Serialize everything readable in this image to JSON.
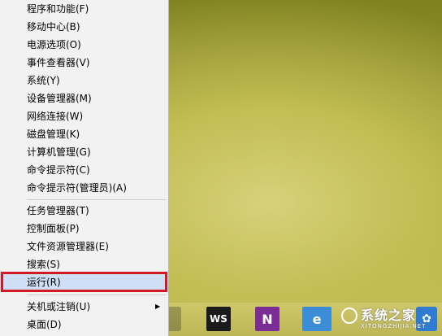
{
  "menu": {
    "group1": [
      {
        "label": "程序和功能(F)"
      },
      {
        "label": "移动中心(B)"
      },
      {
        "label": "电源选项(O)"
      },
      {
        "label": "事件查看器(V)"
      },
      {
        "label": "系统(Y)"
      },
      {
        "label": "设备管理器(M)"
      },
      {
        "label": "网络连接(W)"
      },
      {
        "label": "磁盘管理(K)"
      },
      {
        "label": "计算机管理(G)"
      },
      {
        "label": "命令提示符(C)"
      },
      {
        "label": "命令提示符(管理员)(A)"
      }
    ],
    "group2": [
      {
        "label": "任务管理器(T)"
      },
      {
        "label": "控制面板(P)"
      },
      {
        "label": "文件资源管理器(E)"
      },
      {
        "label": "搜索(S)"
      },
      {
        "label": "运行(R)",
        "highlighted": true
      }
    ],
    "group3": [
      {
        "label": "关机或注销(U)",
        "has_submenu": true,
        "arrow": "▶"
      },
      {
        "label": "桌面(D)"
      }
    ]
  },
  "taskbar": {
    "apps": [
      {
        "name": "webstorm-icon",
        "text": "WS"
      },
      {
        "name": "onenote-icon",
        "text": "N"
      },
      {
        "name": "ie-icon",
        "text": "e"
      },
      {
        "name": "blue-app-icon",
        "text": "✿"
      }
    ]
  },
  "watermark": {
    "main": "系统之家",
    "sub": "XITONGZHIJIA.NET"
  },
  "colors": {
    "highlight": "#cfdff5",
    "annotation_box": "#d21a25",
    "menu_bg": "#f2f2f2"
  }
}
